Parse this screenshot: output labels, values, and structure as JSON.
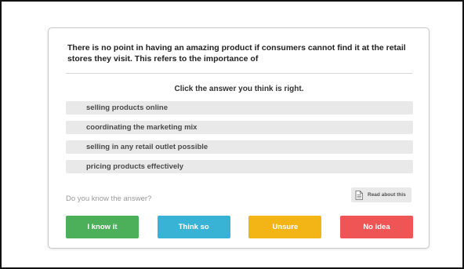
{
  "quiz": {
    "question": "There is no point in having an amazing product if consumers cannot find it at the retail stores they visit. This refers to the importance of",
    "instruction": "Click the answer you think is right.",
    "options": [
      "selling products online",
      "coordinating the marketing mix",
      "selling in any retail outlet possible",
      "pricing products effectively"
    ],
    "prompt": "Do you know the answer?",
    "read_about_label": "Read about this",
    "answers": [
      {
        "label": "I know it",
        "color": "#4caf5a"
      },
      {
        "label": "Think so",
        "color": "#38b3d6"
      },
      {
        "label": "Unsure",
        "color": "#f3b515"
      },
      {
        "label": "No idea",
        "color": "#f05555"
      }
    ]
  }
}
